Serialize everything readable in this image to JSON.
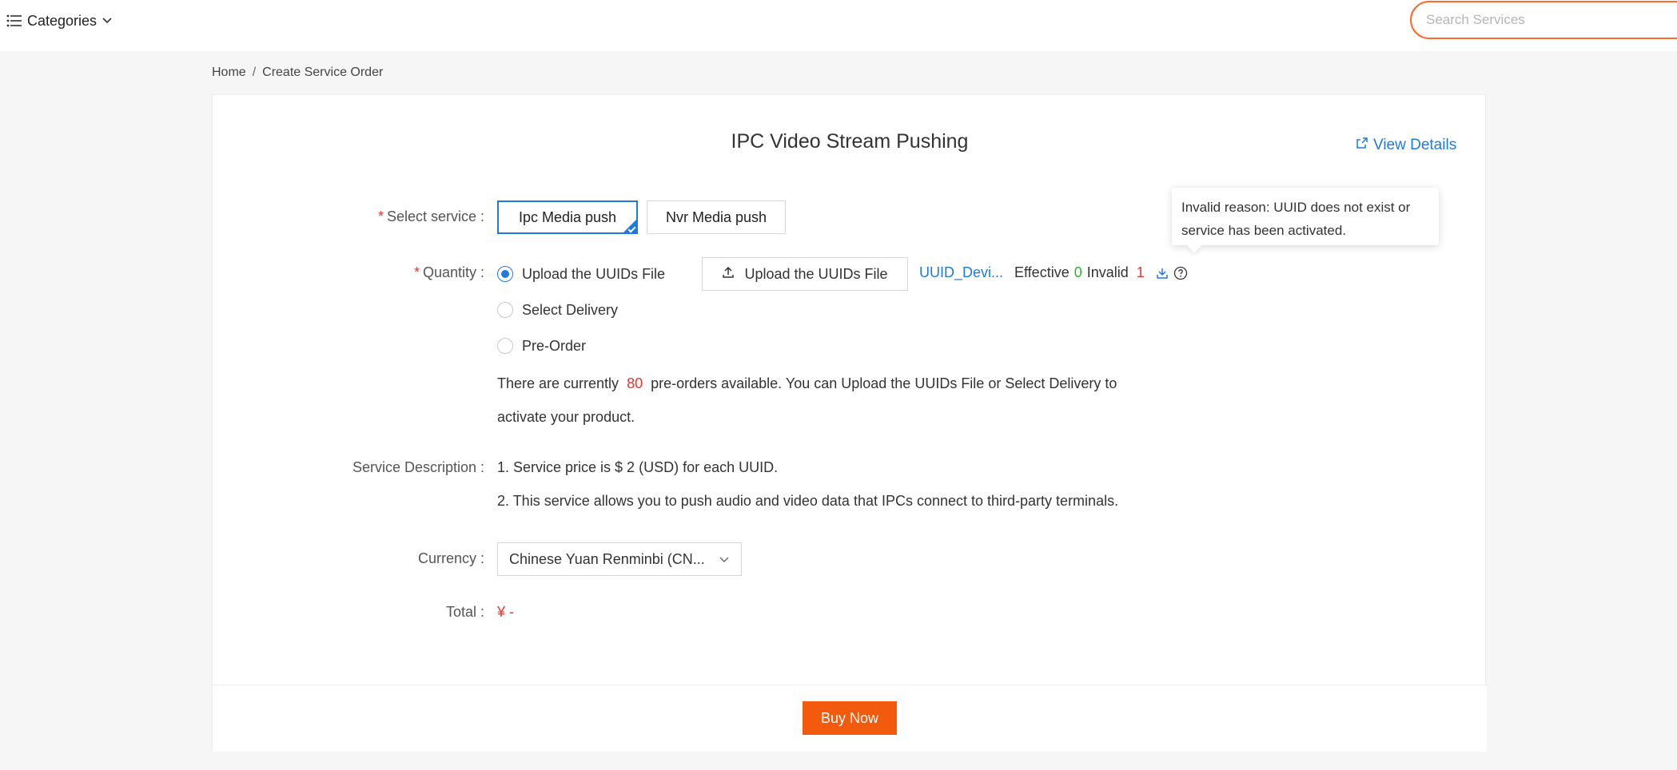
{
  "header": {
    "categories_label": "Categories",
    "search_placeholder": "Search Services"
  },
  "breadcrumb": {
    "home": "Home",
    "separator": "/",
    "current": "Create Service Order"
  },
  "card": {
    "title": "IPC Video Stream Pushing",
    "view_details": "View Details",
    "select_service": {
      "label": "Select service :",
      "required_mark": "*",
      "options": [
        "Ipc Media push",
        "Nvr Media push"
      ],
      "selected": "Ipc Media push"
    },
    "quantity": {
      "label": "Quantity :",
      "required_mark": "*",
      "options": [
        "Upload the UUIDs File",
        "Select Delivery",
        "Pre-Order"
      ],
      "selected": "Upload the UUIDs File",
      "upload_button": "Upload the UUIDs File",
      "file_name": "UUID_Devi...",
      "effective_label": "Effective",
      "effective_count": "0",
      "invalid_label": "Invalid",
      "invalid_count": "1",
      "tooltip": "Invalid reason: UUID does not exist or service has been activated."
    },
    "preorder_info": {
      "prefix": "There are currently",
      "count": "80",
      "suffix": "pre-orders available. You can Upload the UUIDs File or Select Delivery to activate your product."
    },
    "service_description": {
      "label": "Service Description :",
      "lines": [
        "1. Service price is $ 2 (USD) for each UUID.",
        "2. This service allows you to push audio and video data that IPCs connect to third-party terminals."
      ]
    },
    "currency": {
      "label": "Currency :",
      "value": "Chinese Yuan Renminbi (CN..."
    },
    "total": {
      "label": "Total :",
      "value": "¥ -"
    },
    "buy_button": "Buy Now"
  },
  "colors": {
    "accent": "#1f7ae0",
    "brand_orange": "#f25a0e",
    "error": "#e53935",
    "success": "#2eb82e"
  }
}
